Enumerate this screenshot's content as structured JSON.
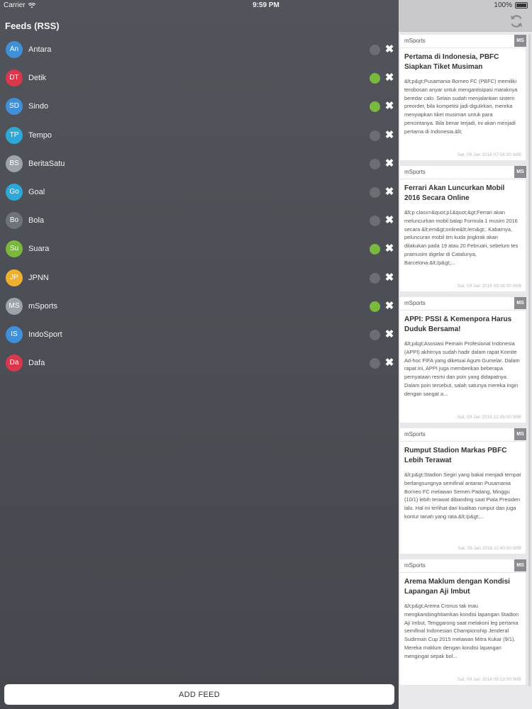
{
  "status_bar": {
    "carrier": "Carrier",
    "time": "9:59 PM",
    "battery": "100%"
  },
  "sidebar": {
    "title": "Feeds (RSS)",
    "feeds": [
      {
        "initials": "An",
        "name": "Antara",
        "color": "#3f8fd9",
        "active": false
      },
      {
        "initials": "DT",
        "name": "Detik",
        "color": "#d9374c",
        "active": true
      },
      {
        "initials": "SD",
        "name": "Sindo",
        "color": "#3f8fd9",
        "active": true
      },
      {
        "initials": "TP",
        "name": "Tempo",
        "color": "#2ea8d8",
        "active": false
      },
      {
        "initials": "BS",
        "name": "BeritaSatu",
        "color": "#9ea2a9",
        "active": false
      },
      {
        "initials": "Go",
        "name": "Goal",
        "color": "#2ea8d8",
        "active": false
      },
      {
        "initials": "Bo",
        "name": "Bola",
        "color": "#6e737b",
        "active": false
      },
      {
        "initials": "Su",
        "name": "Suara",
        "color": "#7ab83e",
        "active": true
      },
      {
        "initials": "JP",
        "name": "JPNN",
        "color": "#efb02f",
        "active": false
      },
      {
        "initials": "MS",
        "name": "mSports",
        "color": "#9ea2a9",
        "active": true
      },
      {
        "initials": "IS",
        "name": "IndoSport",
        "color": "#3f8fd9",
        "active": false
      },
      {
        "initials": "Da",
        "name": "Dafa",
        "color": "#d9374c",
        "active": false
      }
    ],
    "remove_glyph": "✖",
    "add_feed_label": "ADD FEED",
    "active_color": "#7ab83e",
    "inactive_color": "#6b6e74"
  },
  "news": {
    "refresh_icon": "refresh-icon",
    "articles": [
      {
        "source": "mSports",
        "badge": "MS",
        "title": "Pertama di Indonesia, PBFC Siapkan Tiket Musiman",
        "snippet": "&lt;p&gt;Pusamania Borneo FC (PBFC) memiliki terobosan anyar untuk mengantisipasi maraknya beredar calo. Selain sudah menjalankan sistem preorder, bila kompetisi jadi digulirkan, mereka menyiapkan tiket musiman untuk para pencintanya. Bila benar terjadi, ini akan menjadi pertama di Indonesia.&lt;",
        "date": "Sat, 09 Jan 2016 07:56:00 WIB"
      },
      {
        "source": "mSports",
        "badge": "MS",
        "title": "Ferrari Akan Luncurkan Mobil 2016 Secara Online",
        "snippet": "&lt;p class=&quot;p1&quot;&gt;Ferrari akan meluncurkan mobil balap Formula 1 musim 2016 secara &lt;em&gt;online&lt;/em&gt;. Kabarnya, peluncuran mobil tim kuda jingkrak akan dilakukan pada 19 atau 20 Februari, sebelum tes pramusim digelar di Catalunya, Barcelona.&lt;/p&gt;...",
        "date": "Sat, 09 Jan 2016 09:38:00 WIB"
      },
      {
        "source": "mSports",
        "badge": "MS",
        "title": "APPI: PSSI & Kemenpora Harus Duduk Bersama!",
        "snippet": "&lt;p&gt;Asosiasi Pemain Profesional Indonesia (APPI) akhirnya sudah hadir dalam rapat Komite Ad-hoc FIFA yang diketuai Agum Gumelar. Dalam rapat ini, APPI juga memberikan beberapa pernyataan resmi dan poin yang didapatnya. Dalam poin tersebut, salah satunya mereka ingin dengan sangat a...",
        "date": "Sat, 09 Jan 2016 12:45:00 WIB"
      },
      {
        "source": "mSports",
        "badge": "MS",
        "title": "Rumput Stadion Markas PBFC Lebih Terawat",
        "snippet": "&lt;p&gt;Stadion Segiri yang bakal menjadi tempat berlangsungnya semifinal antaran Pusamania Borneo FC melawan Semen Padang, Minggu (10/1) lebih terawat dibanding saat Piala Presiden lalu. Hal ini terlihat dari kualitas rumput dan juga kontur tanah yang rata.&lt;/p&gt;...",
        "date": "Sat, 09 Jan 2016 11:40:00 WIB"
      },
      {
        "source": "mSports",
        "badge": "MS",
        "title": "Arema Maklum dengan Kondisi Lapangan Aji Imbut",
        "snippet": "&lt;p&gt;Arema Cronus tak mau mengkambinghitamkan kondisi lapangan Stadion Aji Imbut, Tenggarong saat melakoni leg pertama semifinal Indonesian Championship Jenderal Sudirman Cup 2015 melawan Mitra Kukar (9/1). Mereka maklum dengan kondisi lapangan mengingat sepak bol...",
        "date": "Sat, 09 Jan 2016 09:13:00 WIB"
      }
    ]
  }
}
